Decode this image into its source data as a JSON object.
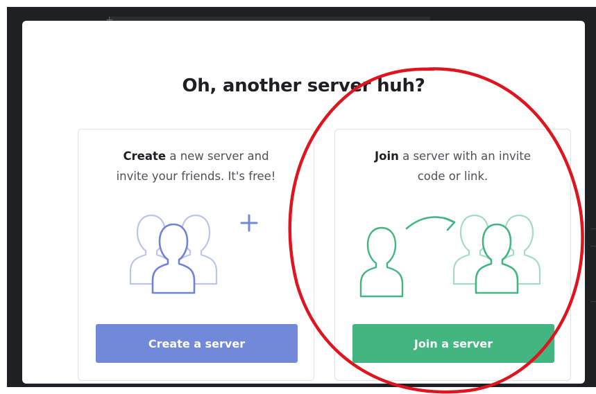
{
  "modal": {
    "title": "Oh, another server huh?"
  },
  "create_card": {
    "bold": "Create",
    "line1_rest": " a new server and",
    "line2": "invite your friends. It's free!",
    "button_label": "Create a server",
    "accent_color": "#7289da"
  },
  "join_card": {
    "bold": "Join",
    "line1_rest": " a server with an invite",
    "line2": "code or link.",
    "button_label": "Join a server",
    "accent_color": "#43b581"
  },
  "annotation": {
    "color": "#e0141e",
    "shape": "ellipse"
  }
}
